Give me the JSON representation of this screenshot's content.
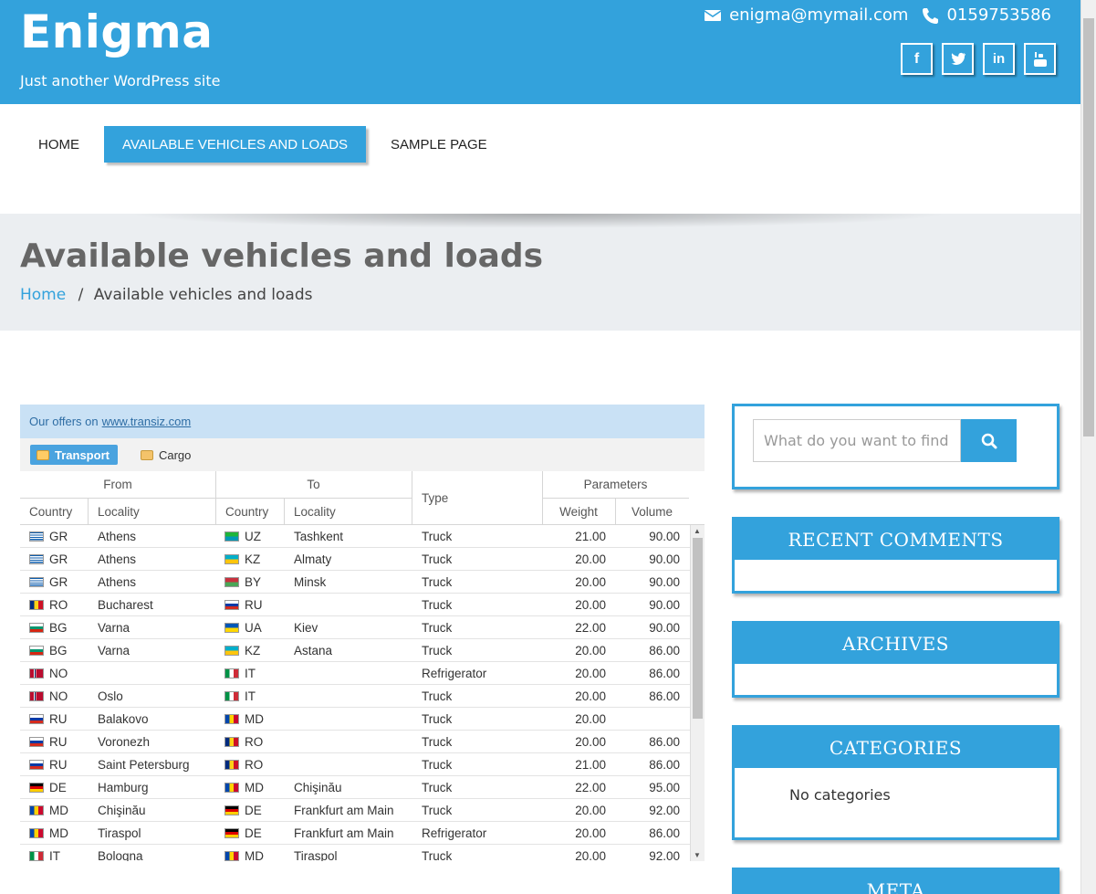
{
  "site": {
    "title": "Enigma",
    "tagline": "Just another WordPress site",
    "email": "enigma@mymail.com",
    "phone": "0159753586",
    "social": [
      "facebook-icon",
      "twitter-icon",
      "linkedin-icon",
      "youtube-icon"
    ],
    "accent": "#33a2dc"
  },
  "nav": {
    "items": [
      {
        "label": "HOME"
      },
      {
        "label": "AVAILABLE VEHICLES AND LOADS"
      },
      {
        "label": "SAMPLE PAGE"
      }
    ]
  },
  "page": {
    "title": "Available vehicles and loads",
    "breadcrumb_home": "Home",
    "breadcrumb_sep": "/",
    "breadcrumb_current": "Available vehicles and loads"
  },
  "widget": {
    "offers_text": "Our offers on",
    "offers_link": "www.transiz.com",
    "tabs": [
      {
        "label": "Transport"
      },
      {
        "label": "Cargo"
      }
    ],
    "headers": {
      "from": "From",
      "to": "To",
      "type": "Type",
      "params": "Parameters",
      "country": "Country",
      "locality": "Locality",
      "weight": "Weight",
      "volume": "Volume"
    },
    "rows": [
      {
        "fc": "GR",
        "fl": "Athens",
        "tc": "UZ",
        "tl": "Tashkent",
        "type": "Truck",
        "w": "21.00",
        "v": "90.00"
      },
      {
        "fc": "GR",
        "fl": "Athens",
        "tc": "KZ",
        "tl": "Almaty",
        "type": "Truck",
        "w": "20.00",
        "v": "90.00"
      },
      {
        "fc": "GR",
        "fl": "Athens",
        "tc": "BY",
        "tl": "Minsk",
        "type": "Truck",
        "w": "20.00",
        "v": "90.00"
      },
      {
        "fc": "RO",
        "fl": "Bucharest",
        "tc": "RU",
        "tl": "",
        "type": "Truck",
        "w": "20.00",
        "v": "90.00"
      },
      {
        "fc": "BG",
        "fl": "Varna",
        "tc": "UA",
        "tl": "Kiev",
        "type": "Truck",
        "w": "22.00",
        "v": "90.00"
      },
      {
        "fc": "BG",
        "fl": "Varna",
        "tc": "KZ",
        "tl": "Astana",
        "type": "Truck",
        "w": "20.00",
        "v": "86.00"
      },
      {
        "fc": "NO",
        "fl": "",
        "tc": "IT",
        "tl": "",
        "type": "Refrigerator",
        "w": "20.00",
        "v": "86.00"
      },
      {
        "fc": "NO",
        "fl": "Oslo",
        "tc": "IT",
        "tl": "",
        "type": "Truck",
        "w": "20.00",
        "v": "86.00"
      },
      {
        "fc": "RU",
        "fl": "Balakovo",
        "tc": "MD",
        "tl": "",
        "type": "Truck",
        "w": "20.00",
        "v": ""
      },
      {
        "fc": "RU",
        "fl": "Voronezh",
        "tc": "RO",
        "tl": "",
        "type": "Truck",
        "w": "20.00",
        "v": "86.00"
      },
      {
        "fc": "RU",
        "fl": "Saint Petersburg",
        "tc": "RO",
        "tl": "",
        "type": "Truck",
        "w": "21.00",
        "v": "86.00"
      },
      {
        "fc": "DE",
        "fl": "Hamburg",
        "tc": "MD",
        "tl": "Chişinău",
        "type": "Truck",
        "w": "22.00",
        "v": "95.00"
      },
      {
        "fc": "MD",
        "fl": "Chişinău",
        "tc": "DE",
        "tl": "Frankfurt am Main",
        "type": "Truck",
        "w": "20.00",
        "v": "92.00"
      },
      {
        "fc": "MD",
        "fl": "Tiraspol",
        "tc": "DE",
        "tl": "Frankfurt am Main",
        "type": "Refrigerator",
        "w": "20.00",
        "v": "86.00"
      },
      {
        "fc": "IT",
        "fl": "Bologna",
        "tc": "MD",
        "tl": "Tiraspol",
        "type": "Truck",
        "w": "20.00",
        "v": "92.00"
      }
    ]
  },
  "sidebar": {
    "search_placeholder": "What do you want to find",
    "recent_comments": "RECENT COMMENTS",
    "archives": "ARCHIVES",
    "categories": "CATEGORIES",
    "no_categories": "No categories",
    "meta": "META"
  },
  "flag_colors": {
    "GR": [
      "#0d5eaf",
      "#ffffff"
    ],
    "UZ": [
      "#1eb53a",
      "#0099b5"
    ],
    "KZ": [
      "#00afca",
      "#fec50c"
    ],
    "BY": [
      "#c8313e",
      "#4aa657"
    ],
    "RO": [
      "#002b7f",
      "#fcd116",
      "#ce1126"
    ],
    "RU": [
      "#ffffff",
      "#0039a6",
      "#d52b1e"
    ],
    "BG": [
      "#ffffff",
      "#00966e",
      "#d62612"
    ],
    "UA": [
      "#0057b7",
      "#ffd700"
    ],
    "NO": [
      "#ba0c2f",
      "#00205b"
    ],
    "IT": [
      "#009246",
      "#ffffff",
      "#ce2b37"
    ],
    "MD": [
      "#0046ae",
      "#ffd200",
      "#cc092f"
    ],
    "DE": [
      "#000000",
      "#dd0000",
      "#ffce00"
    ]
  }
}
